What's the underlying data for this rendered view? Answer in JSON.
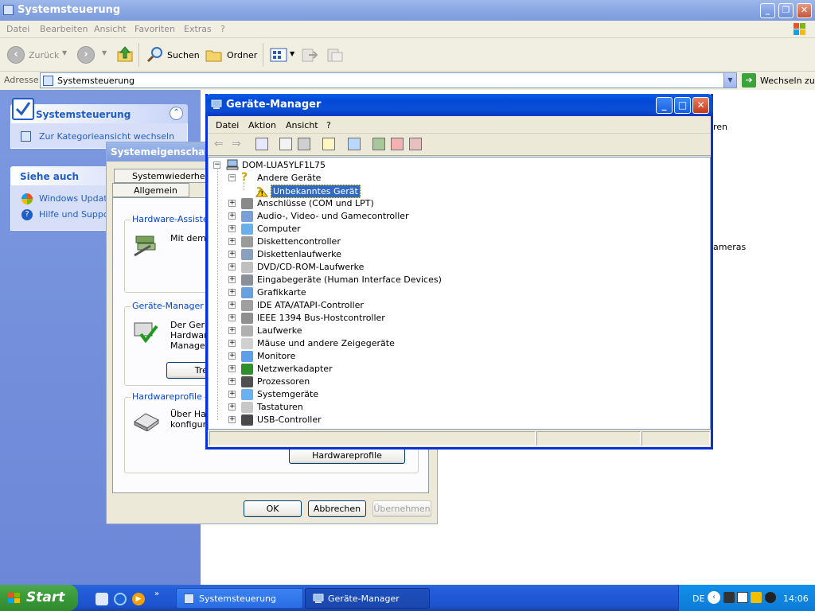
{
  "main_window": {
    "title": "Systemsteuerung",
    "menu": [
      "Datei",
      "Bearbeiten",
      "Ansicht",
      "Favoriten",
      "Extras",
      "?"
    ],
    "toolbar": {
      "back": "Zurück",
      "search": "Suchen",
      "folders": "Ordner"
    },
    "address_label": "Adresse",
    "address_value": "Systemsteuerung",
    "go_label": "Wechseln zu"
  },
  "left_pane": {
    "panel_title": "Systemsteuerung",
    "switch_link": "Zur Kategorieansicht wechseln",
    "see_also_title": "Siehe auch",
    "see_also": [
      "Windows Update",
      "Hilfe und Support"
    ]
  },
  "right_pane": {
    "partial_1": "ren",
    "partial_2": "ameras"
  },
  "system_properties": {
    "title": "Systemeigenschaften",
    "tabs": [
      "Systemwiederherstellung",
      "Allgemein"
    ],
    "groups": {
      "hardware_wizard": {
        "label": "Hardware-Assistent",
        "text": "Mit dem H"
      },
      "device_manager": {
        "label": "Geräte-Manager",
        "text": [
          "Der Gerät",
          "Hardware",
          "Manager,"
        ],
        "button": "Trei"
      },
      "hardware_profiles": {
        "label": "Hardwareprofile",
        "text": [
          "Über Har",
          "konfigura"
        ],
        "button": "Hardwareprofile"
      }
    },
    "buttons": {
      "ok": "OK",
      "cancel": "Abbrechen",
      "apply": "Übernehmen"
    }
  },
  "device_manager": {
    "title": "Geräte-Manager",
    "menu": [
      "Datei",
      "Aktion",
      "Ansicht",
      "?"
    ],
    "root": "DOM-LUA5YLF1L75",
    "tree": [
      {
        "label": "Andere Geräte",
        "expanded": true,
        "children": [
          "Unbekanntes Gerät"
        ]
      },
      {
        "label": "Anschlüsse (COM und LPT)"
      },
      {
        "label": "Audio-, Video- und Gamecontroller"
      },
      {
        "label": "Computer"
      },
      {
        "label": "Diskettencontroller"
      },
      {
        "label": "Diskettenlaufwerke"
      },
      {
        "label": "DVD/CD-ROM-Laufwerke"
      },
      {
        "label": "Eingabegeräte (Human Interface Devices)"
      },
      {
        "label": "Grafikkarte"
      },
      {
        "label": "IDE ATA/ATAPI-Controller"
      },
      {
        "label": "IEEE 1394 Bus-Hostcontroller"
      },
      {
        "label": "Laufwerke"
      },
      {
        "label": "Mäuse und andere Zeigegeräte"
      },
      {
        "label": "Monitore"
      },
      {
        "label": "Netzwerkadapter"
      },
      {
        "label": "Prozessoren"
      },
      {
        "label": "Systemgeräte"
      },
      {
        "label": "Tastaturen"
      },
      {
        "label": "USB-Controller"
      }
    ],
    "selected": "Unbekanntes Gerät"
  },
  "taskbar": {
    "start": "Start",
    "tasks": [
      "Systemsteuerung",
      "Geräte-Manager"
    ],
    "language": "DE",
    "clock": "14:06"
  }
}
